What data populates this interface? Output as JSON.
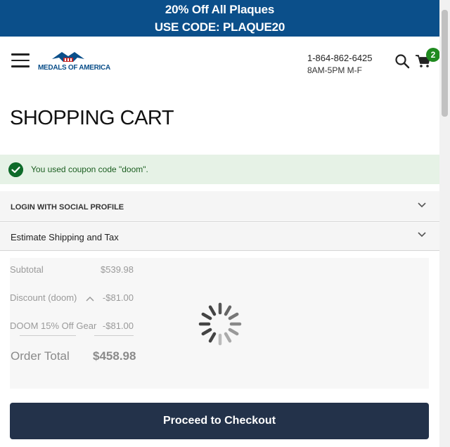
{
  "promo": {
    "line1": "20% Off All Plaques",
    "line2": "USE CODE: PLAQUE20",
    "background": "#0b4f8a"
  },
  "header": {
    "logo_text": "MEDALS OF AMERICA",
    "phone": "1-864-862-6425",
    "hours": "8AM-5PM M-F",
    "cart_count": "2",
    "icons": [
      "hamburger-menu-icon",
      "search-icon",
      "cart-icon"
    ]
  },
  "page": {
    "title": "SHOPPING CART"
  },
  "notice": {
    "message": "You used coupon code \"doom\".",
    "color": "#1b5e20"
  },
  "accordions": {
    "social_login": "LOGIN WITH SOCIAL PROFILE",
    "shipping": "Estimate Shipping and Tax"
  },
  "summary": {
    "subtotal_label": "Subtotal",
    "subtotal_value": "$539.98",
    "discount_label": "Discount (doom)",
    "discount_value": "-$81.00",
    "discount_detail_label": "DOOM 15% Off Gear",
    "discount_detail_value": "-$81.00",
    "total_label": "Order Total",
    "total_value": "$458.98"
  },
  "checkout": {
    "label": "Proceed to Checkout",
    "color": "#23324a"
  }
}
